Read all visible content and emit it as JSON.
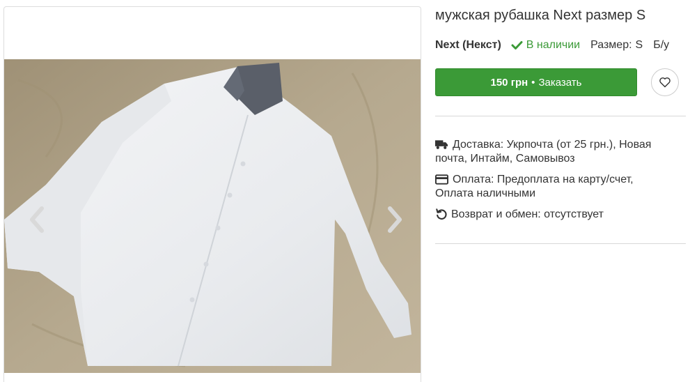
{
  "product": {
    "title": "мужская рубашка Next размер S",
    "brand": "Next (Некст)",
    "stock_status": "В наличии",
    "size_label": "Размер:",
    "size_value": "S",
    "condition": "Б/у"
  },
  "order": {
    "price": "150 грн",
    "separator": "•",
    "action_label": "Заказать"
  },
  "details": {
    "delivery": "Доставка: Укрпочта (от 25 грн.), Новая почта, Интайм, Самовывоз",
    "payment": "Оплата: Предоплата на карту/счет, Оплата наличными",
    "returns": "Возврат и обмен: отсутствует"
  },
  "icons": {
    "stock": "check-icon",
    "favorite": "heart-icon",
    "delivery": "truck-icon",
    "payment": "credit-card-icon",
    "returns": "undo-icon",
    "prev": "chevron-left-icon",
    "next": "chevron-right-icon"
  },
  "colors": {
    "accent": "#3b9a37",
    "text": "#333333",
    "divider": "#d8d8d8"
  }
}
